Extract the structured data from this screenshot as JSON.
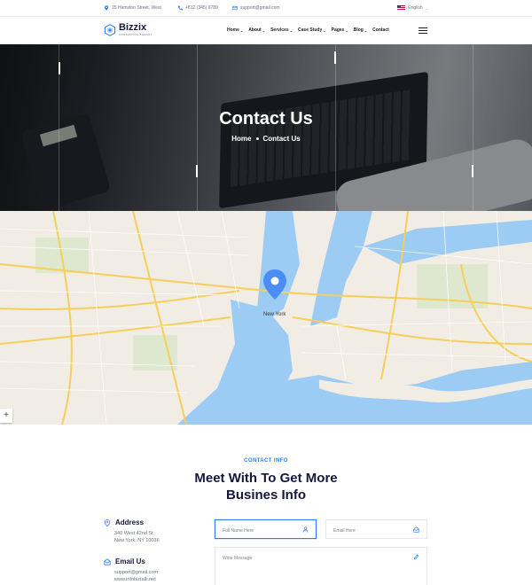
{
  "topbar": {
    "address": "15 Hamston Street, West",
    "phone": "+812 (345) 6789",
    "email": "support@gmail.com",
    "language": "English",
    "accent_color": "#2b7dfa"
  },
  "brand": {
    "name": "Bizzix",
    "tagline": "CONSULTING AGENCY"
  },
  "nav": {
    "items": [
      {
        "label": "Home",
        "dropdown": true
      },
      {
        "label": "About",
        "dropdown": true
      },
      {
        "label": "Services",
        "dropdown": true
      },
      {
        "label": "Case Study",
        "dropdown": true
      },
      {
        "label": "Pages",
        "dropdown": true
      },
      {
        "label": "Blog",
        "dropdown": true
      },
      {
        "label": "Contact",
        "dropdown": false
      }
    ]
  },
  "hero": {
    "title": "Contact Us",
    "breadcrumb": [
      "Home",
      "Contact Us"
    ]
  },
  "map": {
    "city_label": "New York",
    "marker_color": "#4a8ef5"
  },
  "contact": {
    "tag": "CONTACT INFO",
    "title_line1": "Meet With To Get More",
    "title_line2": "Busines Info",
    "address": {
      "label": "Address",
      "lines": [
        "340 West 42nd St",
        "New York, NY 10036"
      ]
    },
    "email": {
      "label": "Email Us",
      "lines": [
        "support@gmail.com",
        "www.infobiztalk.net"
      ]
    },
    "form": {
      "name_placeholder": "Full Name Here",
      "email_placeholder": "Email Here",
      "message_placeholder": "Write Message"
    }
  }
}
